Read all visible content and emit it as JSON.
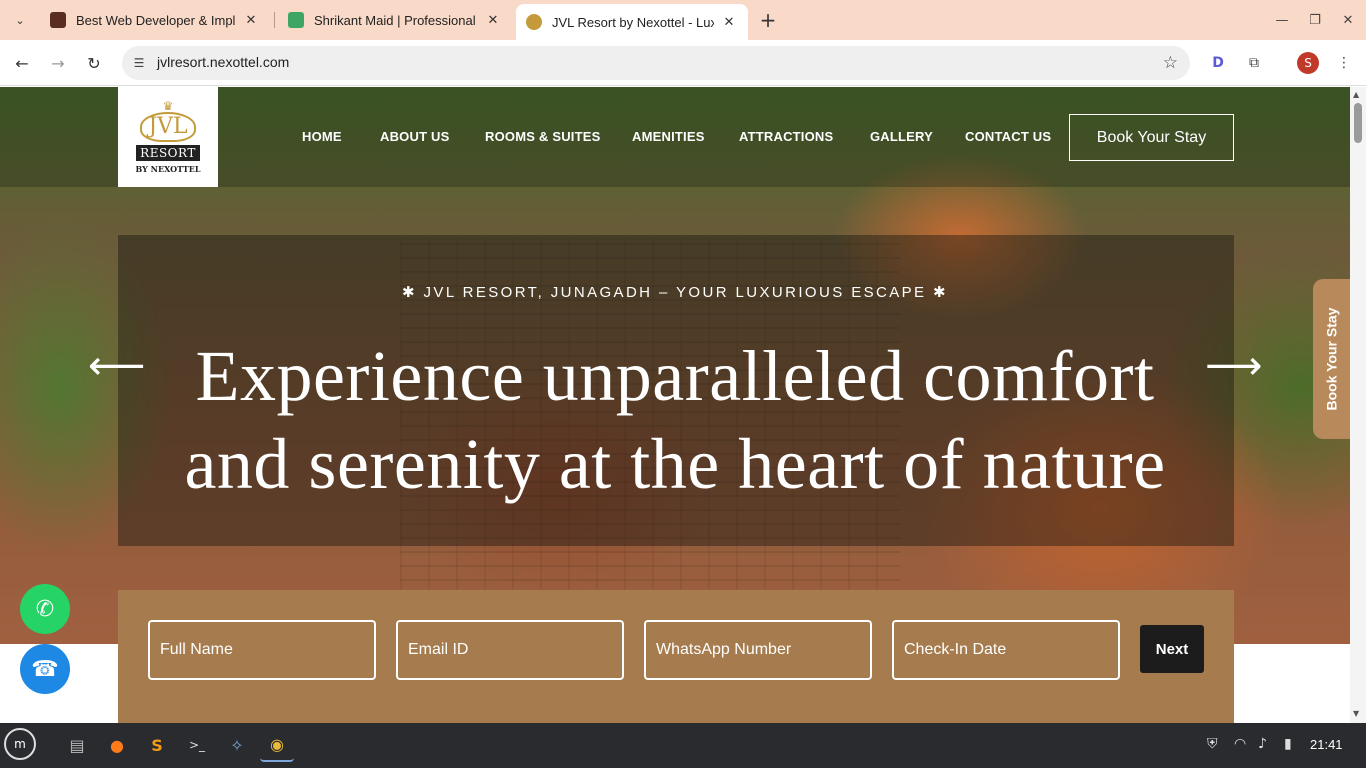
{
  "browser": {
    "tabs": [
      {
        "title": "Best Web Developer & Imple",
        "favicon_color": "#5a2d22"
      },
      {
        "title": "Shrikant Maid | Professional",
        "favicon_color": "#3fa564"
      },
      {
        "title": "JVL Resort by Nexottel - Lux",
        "favicon_color": "#c49a3a"
      }
    ],
    "active_tab": 2,
    "url": "jvlresort.nexottel.com",
    "profile_initial": "S"
  },
  "site": {
    "logo": {
      "monogram": "JVL",
      "resort": "RESORT",
      "by": "BY NEXOTTEL"
    },
    "nav": [
      "HOME",
      "ABOUT US",
      "ROOMS & SUITES",
      "AMENITIES",
      "ATTRACTIONS",
      "GALLERY",
      "CONTACT US"
    ],
    "book_button": "Book Your Stay",
    "kicker": "✱  JVL RESORT, JUNAGADH – YOUR LUXURIOUS ESCAPE  ✱",
    "headline_line1": "Experience unparalleled comfort",
    "headline_line2": "and serenity at the heart of nature",
    "side_tab": "Book Your Stay",
    "form": {
      "fields": [
        "Full Name",
        "Email ID",
        "WhatsApp Number",
        "Check-In Date"
      ],
      "next": "Next"
    }
  },
  "taskbar": {
    "clock": "21:41"
  },
  "colors": {
    "tabstrip": "#f9d9c7",
    "form_bar": "#a67c4e",
    "side_tab": "#b8895a",
    "whatsapp": "#25d366",
    "phone": "#1e88e5"
  }
}
